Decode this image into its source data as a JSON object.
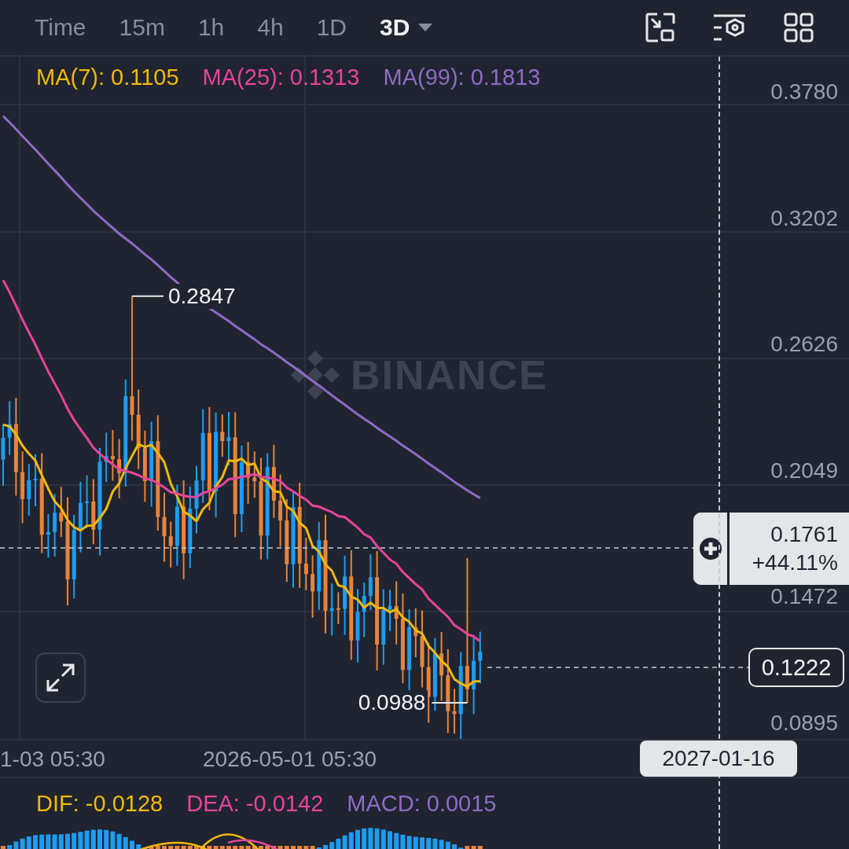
{
  "toolbar": {
    "intervals": [
      {
        "label": "Time",
        "selected": false
      },
      {
        "label": "15m",
        "selected": false
      },
      {
        "label": "1h",
        "selected": false
      },
      {
        "label": "4h",
        "selected": false
      },
      {
        "label": "1D",
        "selected": false
      },
      {
        "label": "3D",
        "selected": true
      }
    ]
  },
  "legend": [
    {
      "label": "MA(7): 0.1105",
      "color": "#f0b90b"
    },
    {
      "label": "MA(25): 0.1313",
      "color": "#e8449b"
    },
    {
      "label": "MA(99): 0.1813",
      "color": "#8e6bc6"
    }
  ],
  "watermark": "BINANCE",
  "price_axis": [
    "0.3780",
    "0.3202",
    "0.2626",
    "0.2049",
    "0.1472",
    "0.0895"
  ],
  "high_marker": "0.2847",
  "low_marker": "0.0988",
  "crosshair": {
    "price": "0.1761",
    "change": "+44.11%",
    "date": "2027-01-16"
  },
  "last_price": "0.1222",
  "time_axis": [
    "1-03 05:30",
    "2026-05-01 05:30"
  ],
  "macd_legend": [
    {
      "label": "DIF: -0.0128",
      "color": "#f0b90b"
    },
    {
      "label": "DEA: -0.0142",
      "color": "#e8449b"
    },
    {
      "label": "MACD: 0.0015",
      "color": "#8e6bc6"
    }
  ]
}
